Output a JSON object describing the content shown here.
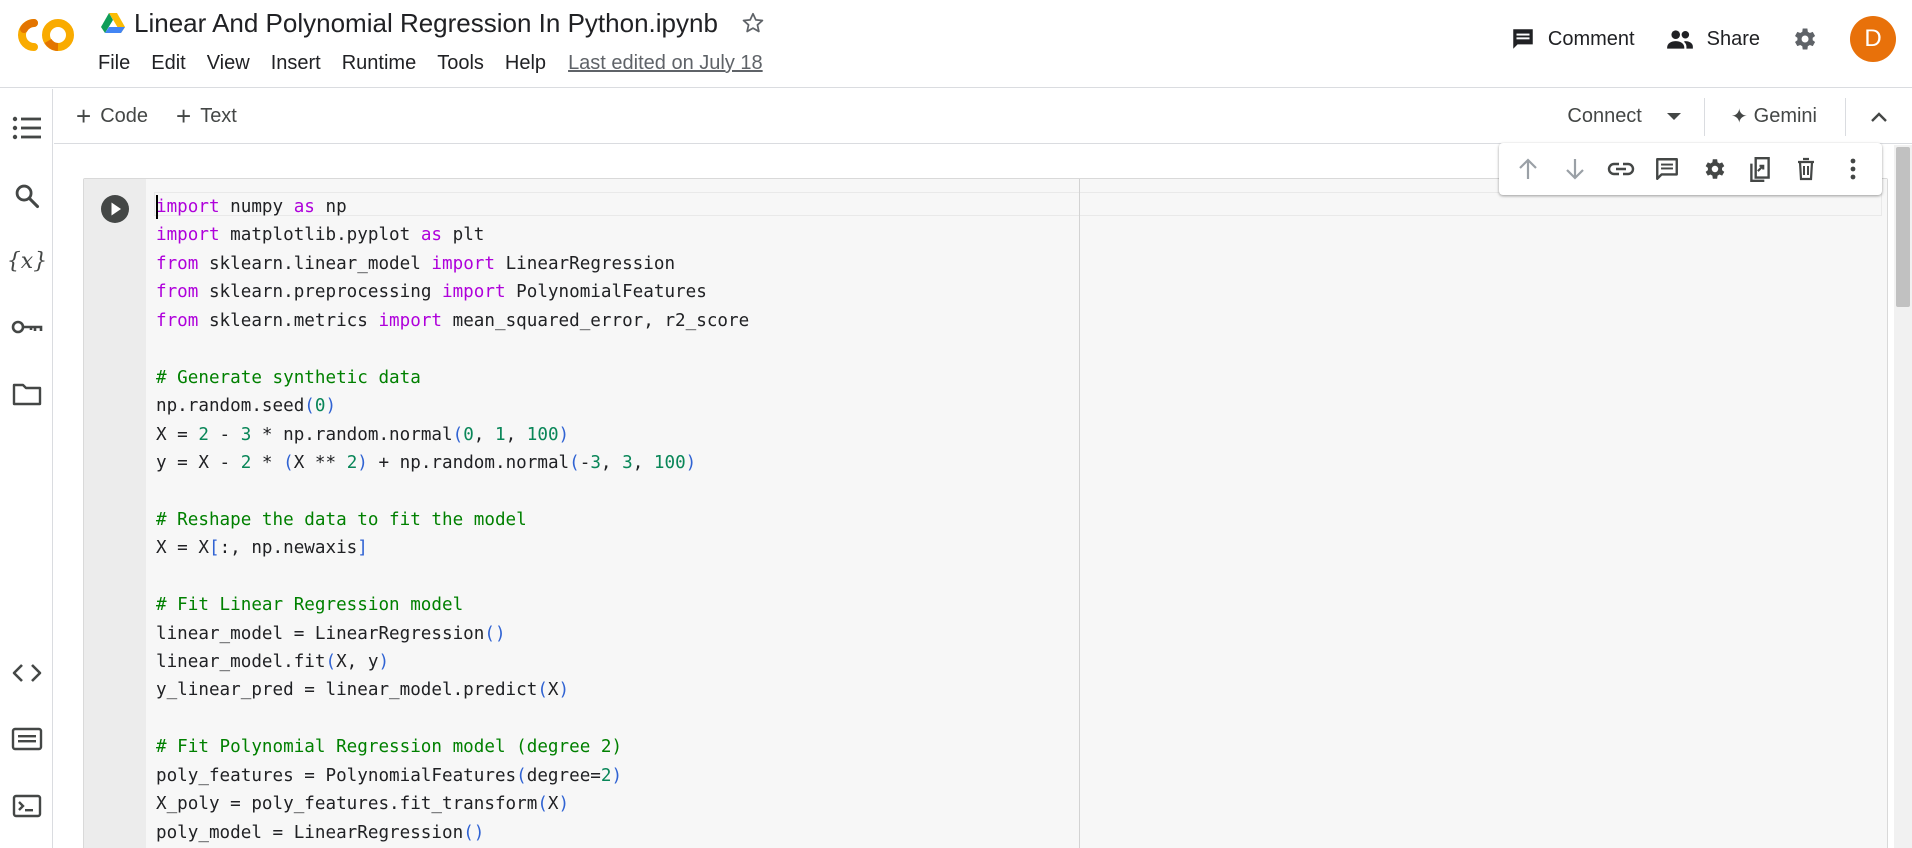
{
  "header": {
    "title": "Linear And Polynomial Regression In Python.ipynb",
    "menu": [
      "File",
      "Edit",
      "View",
      "Insert",
      "Runtime",
      "Tools",
      "Help"
    ],
    "last_edited": "Last edited on July 18",
    "comment_label": "Comment",
    "share_label": "Share",
    "avatar_letter": "D"
  },
  "rail": {
    "icons": [
      "table-of-contents-icon",
      "search-icon",
      "variables-icon",
      "secrets-key-icon",
      "files-folder-icon",
      "code-snippets-icon",
      "command-palette-icon",
      "terminal-icon"
    ]
  },
  "toolbar": {
    "add_code": "Code",
    "add_text": "Text",
    "connect": "Connect",
    "gemini": "Gemini"
  },
  "cell_toolbar": {
    "icons": [
      "move-up-icon",
      "move-down-icon",
      "link-icon",
      "comment-icon",
      "settings-icon",
      "mirror-cell-icon",
      "delete-icon",
      "more-options-icon"
    ]
  },
  "code_lines": [
    [
      {
        "t": "kw",
        "v": "import"
      },
      {
        "t": "p",
        "v": " numpy "
      },
      {
        "t": "kw",
        "v": "as"
      },
      {
        "t": "p",
        "v": " np"
      }
    ],
    [
      {
        "t": "kw",
        "v": "import"
      },
      {
        "t": "p",
        "v": " matplotlib.pyplot "
      },
      {
        "t": "kw",
        "v": "as"
      },
      {
        "t": "p",
        "v": " plt"
      }
    ],
    [
      {
        "t": "kw",
        "v": "from"
      },
      {
        "t": "p",
        "v": " sklearn.linear_model "
      },
      {
        "t": "kw",
        "v": "import"
      },
      {
        "t": "p",
        "v": " LinearRegression"
      }
    ],
    [
      {
        "t": "kw",
        "v": "from"
      },
      {
        "t": "p",
        "v": " sklearn.preprocessing "
      },
      {
        "t": "kw",
        "v": "import"
      },
      {
        "t": "p",
        "v": " PolynomialFeatures"
      }
    ],
    [
      {
        "t": "kw",
        "v": "from"
      },
      {
        "t": "p",
        "v": " sklearn.metrics "
      },
      {
        "t": "kw",
        "v": "import"
      },
      {
        "t": "p",
        "v": " mean_squared_error, r2_score"
      }
    ],
    [],
    [
      {
        "t": "cm",
        "v": "# Generate synthetic data"
      }
    ],
    [
      {
        "t": "p",
        "v": "np.random.seed"
      },
      {
        "t": "br",
        "v": "("
      },
      {
        "t": "num",
        "v": "0"
      },
      {
        "t": "br",
        "v": ")"
      }
    ],
    [
      {
        "t": "p",
        "v": "X = "
      },
      {
        "t": "num",
        "v": "2"
      },
      {
        "t": "p",
        "v": " - "
      },
      {
        "t": "num",
        "v": "3"
      },
      {
        "t": "p",
        "v": " * np.random.normal"
      },
      {
        "t": "br",
        "v": "("
      },
      {
        "t": "num",
        "v": "0"
      },
      {
        "t": "p",
        "v": ", "
      },
      {
        "t": "num",
        "v": "1"
      },
      {
        "t": "p",
        "v": ", "
      },
      {
        "t": "num",
        "v": "100"
      },
      {
        "t": "br",
        "v": ")"
      }
    ],
    [
      {
        "t": "p",
        "v": "y = X - "
      },
      {
        "t": "num",
        "v": "2"
      },
      {
        "t": "p",
        "v": " * "
      },
      {
        "t": "br",
        "v": "("
      },
      {
        "t": "p",
        "v": "X ** "
      },
      {
        "t": "num",
        "v": "2"
      },
      {
        "t": "br",
        "v": ")"
      },
      {
        "t": "p",
        "v": " + np.random.normal"
      },
      {
        "t": "br",
        "v": "("
      },
      {
        "t": "p",
        "v": "-"
      },
      {
        "t": "num",
        "v": "3"
      },
      {
        "t": "p",
        "v": ", "
      },
      {
        "t": "num",
        "v": "3"
      },
      {
        "t": "p",
        "v": ", "
      },
      {
        "t": "num",
        "v": "100"
      },
      {
        "t": "br",
        "v": ")"
      }
    ],
    [],
    [
      {
        "t": "cm",
        "v": "# Reshape the data to fit the model"
      }
    ],
    [
      {
        "t": "p",
        "v": "X = X"
      },
      {
        "t": "br",
        "v": "["
      },
      {
        "t": "p",
        "v": ":, np.newaxis"
      },
      {
        "t": "br",
        "v": "]"
      }
    ],
    [],
    [
      {
        "t": "cm",
        "v": "# Fit Linear Regression model"
      }
    ],
    [
      {
        "t": "p",
        "v": "linear_model = LinearRegression"
      },
      {
        "t": "br",
        "v": "()"
      }
    ],
    [
      {
        "t": "p",
        "v": "linear_model.fit"
      },
      {
        "t": "br",
        "v": "("
      },
      {
        "t": "p",
        "v": "X, y"
      },
      {
        "t": "br",
        "v": ")"
      }
    ],
    [
      {
        "t": "p",
        "v": "y_linear_pred = linear_model.predict"
      },
      {
        "t": "br",
        "v": "("
      },
      {
        "t": "p",
        "v": "X"
      },
      {
        "t": "br",
        "v": ")"
      }
    ],
    [],
    [
      {
        "t": "cm",
        "v": "# Fit Polynomial Regression model (degree 2)"
      }
    ],
    [
      {
        "t": "p",
        "v": "poly_features = PolynomialFeatures"
      },
      {
        "t": "br",
        "v": "("
      },
      {
        "t": "p",
        "v": "degree="
      },
      {
        "t": "num",
        "v": "2"
      },
      {
        "t": "br",
        "v": ")"
      }
    ],
    [
      {
        "t": "p",
        "v": "X_poly = poly_features.fit_transform"
      },
      {
        "t": "br",
        "v": "("
      },
      {
        "t": "p",
        "v": "X"
      },
      {
        "t": "br",
        "v": ")"
      }
    ],
    [
      {
        "t": "p",
        "v": "poly_model = LinearRegression"
      },
      {
        "t": "br",
        "v": "()"
      }
    ]
  ]
}
